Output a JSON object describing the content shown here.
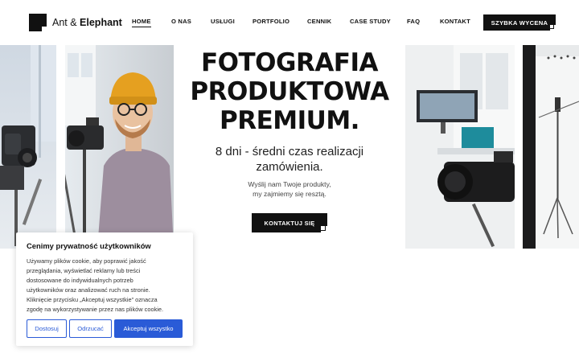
{
  "header": {
    "logo": {
      "text_part1": "Ant & ",
      "text_part2": "Elephant"
    },
    "nav": [
      {
        "label": "HOME",
        "active": true
      },
      {
        "label": "O NAS"
      },
      {
        "label": "USŁUGI"
      },
      {
        "label": "PORTFOLIO"
      },
      {
        "label": "CENNIK"
      },
      {
        "label": "CASE STUDY"
      },
      {
        "label": "FAQ"
      },
      {
        "label": "KONTAKT"
      }
    ],
    "cta_label": "SZYBKA WYCENA"
  },
  "hero": {
    "title_lines": [
      "FOTOGRAFIA",
      "PRODUKTOWA",
      "PREMIUM."
    ],
    "subtitle_lines": [
      "8 dni - średni czas realizacji",
      "zamówienia."
    ],
    "small_lines": [
      "Wyślij nam Twoje produkty,",
      "my zajmiemy się resztą."
    ],
    "button_label": "KONTAKTUJ SIĘ"
  },
  "cookie": {
    "title": "Cenimy prywatność użytkowników",
    "text_lines": [
      "Używamy plików cookie, aby poprawić jakość",
      "przeglądania, wyświetlać reklamy lub treści",
      "dostosowane do indywidualnych potrzeb",
      "użytkowników oraz analizować ruch na stronie.",
      "Kliknięcie przycisku „Akceptuj wszystkie” oznacza",
      "zgodę na wykorzystywanie przez nas plików cookie."
    ],
    "buttons": {
      "customize": "Dostosuj",
      "reject": "Odrzucać",
      "accept": "Akceptuj wszystko"
    }
  },
  "colors": {
    "brand_dark": "#111111",
    "cookie_accent": "#2a5bd7",
    "background": "#ffffff"
  },
  "icons": {
    "logo": "square-logo-icon",
    "camera": "camera-photo"
  }
}
